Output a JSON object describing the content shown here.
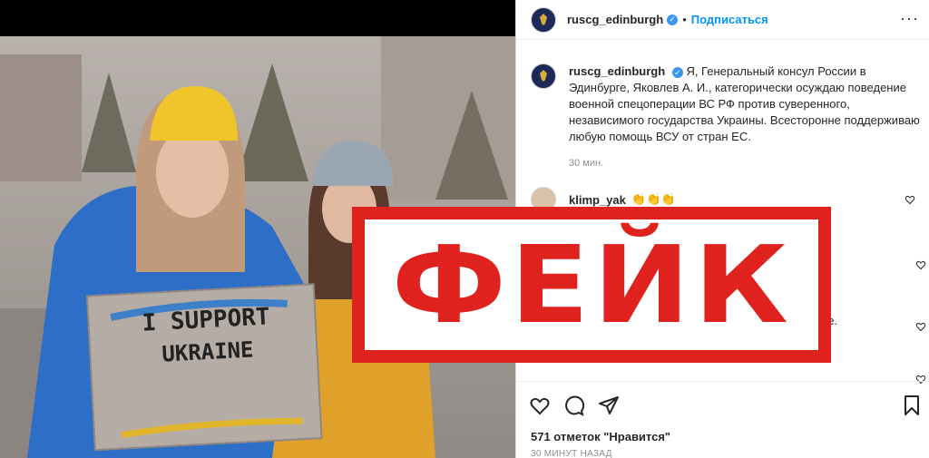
{
  "header": {
    "username": "ruscg_edinburgh",
    "separator": "•",
    "follow_label": "Подписаться",
    "more_label": "···"
  },
  "caption": {
    "username": "ruscg_edinburgh",
    "text": "Я, Генеральный консул России в Эдинбурге, Яковлев А. И., категорически осуждаю поведение военной спецоперации ВС РФ против суверенного, независимого государства Украины. Всесторонне поддерживаю любую помощь ВСУ от стран ЕС.",
    "time": "30 мин."
  },
  "comments": [
    {
      "username": "klimp_yak",
      "text": "👏👏👏"
    }
  ],
  "partial_comment_text": "ne.",
  "photo": {
    "sign_line1": "I SUPPORT",
    "sign_line2": "UKRAINE"
  },
  "engagement": {
    "likes": "571 отметок \"Нравится\"",
    "time": "30 МИНУТ НАЗАД"
  },
  "stamp": {
    "text": "ФЕЙК",
    "color": "#e0221e"
  },
  "colors": {
    "follow": "#0095f6",
    "verified": "#3897f0"
  }
}
